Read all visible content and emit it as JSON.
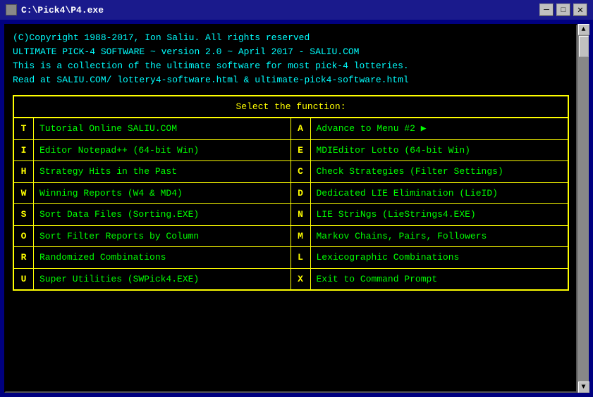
{
  "titleBar": {
    "title": "C:\\Pick4\\P4.exe",
    "minimizeLabel": "─",
    "maximizeLabel": "□",
    "closeLabel": "✕"
  },
  "header": {
    "line1": "(C)Copyright 1988-2017, Ion Saliu. All rights reserved",
    "line2": "ULTIMATE PICK-4 SOFTWARE ~ version 2.0 ~ April 2017 - SALIU.COM",
    "line3": "This is a collection of the ultimate software for most pick-4 lotteries.",
    "line4": "Read at SALIU.COM/ lottery4-software.html & ultimate-pick4-software.html"
  },
  "menu": {
    "title": "Select the function:",
    "items": [
      {
        "key": "T",
        "label": "Tutorial Online SALIU.COM"
      },
      {
        "key": "A",
        "label": "Advance to Menu #2 ▶"
      },
      {
        "key": "I",
        "label": "Editor Notepad++ (64-bit Win)"
      },
      {
        "key": "E",
        "label": "MDIEditor Lotto (64-bit Win)"
      },
      {
        "key": "H",
        "label": "Strategy Hits in the Past"
      },
      {
        "key": "C",
        "label": "Check Strategies (Filter Settings)"
      },
      {
        "key": "W",
        "label": "Winning Reports (W4 & MD4)"
      },
      {
        "key": "D",
        "label": "Dedicated LIE Elimination (LieID)"
      },
      {
        "key": "S",
        "label": "Sort Data Files (Sorting.EXE)"
      },
      {
        "key": "N",
        "label": "LIE StriNgs (LieStrings4.EXE)"
      },
      {
        "key": "O",
        "label": "Sort Filter Reports by Column"
      },
      {
        "key": "M",
        "label": "Markov Chains, Pairs, Followers"
      },
      {
        "key": "R",
        "label": "Randomized Combinations"
      },
      {
        "key": "L",
        "label": "Lexicographic Combinations"
      },
      {
        "key": "U",
        "label": "Super Utilities (SWPick4.EXE)"
      },
      {
        "key": "X",
        "label": "Exit to Command Prompt"
      }
    ]
  }
}
